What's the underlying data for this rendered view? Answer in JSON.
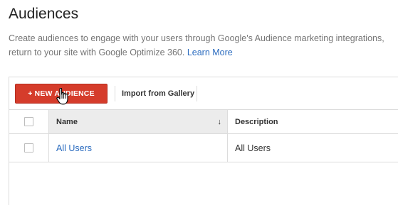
{
  "header": {
    "title": "Audiences",
    "description_line1": "Create audiences to engage with your users through Google's Audience marketing integrations,",
    "description_line2": "return to your site with Google Optimize 360.",
    "learn_more": "Learn More"
  },
  "toolbar": {
    "new_audience_plus": "+",
    "new_audience_label": "NEW AUDIENCE",
    "import_label": "Import from Gallery"
  },
  "table": {
    "columns": [
      "Name",
      "Description"
    ],
    "sort_icon": "arrow-down-icon",
    "sort_glyph": "↓",
    "rows": [
      {
        "name": "All Users",
        "description": "All Users"
      }
    ]
  },
  "colors": {
    "primary_button": "#d53c2b",
    "link": "#2a6bbf"
  }
}
